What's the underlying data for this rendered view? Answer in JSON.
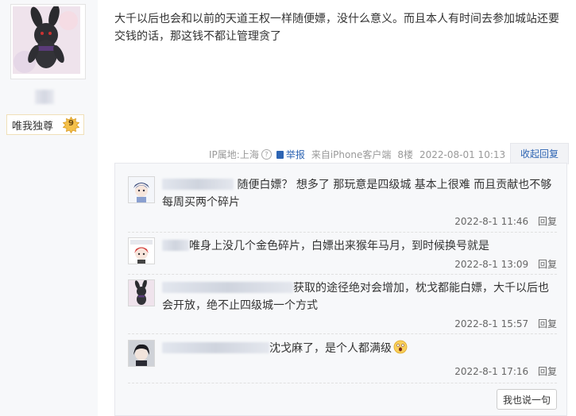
{
  "author": {
    "avatar_icon": "bunny-doll-avatar",
    "badge_name": "唯我独尊",
    "badge_level": "9",
    "badge_color": "#f2b53a"
  },
  "post": {
    "content": "大千以后也会和以前的天道王权一样随便嫖，没什么意义。而且本人有时间去参加城站还要交钱的话，那这钱不都让管理贪了",
    "ip_location": "IP属地:上海",
    "report_label": "举报",
    "source": "来自iPhone客户端",
    "floor": "8楼",
    "timestamp": "2022-08-01 10:13",
    "collapse_label": "收起回复"
  },
  "replies": [
    {
      "avatar_icon": "anime-girl-blue-avatar",
      "text": "随便白嫖？ 想多了 那玩意是四级城 基本上很难 而且贡献也不够每周买两个碎片",
      "time": "2022-8-1 11:46",
      "reply_label": "回复"
    },
    {
      "avatar_icon": "chibi-red-hair-avatar",
      "text": "唯身上没几个金色碎片，白嫖出来猴年马月，到时候换号就是",
      "time": "2022-8-1 13:09",
      "reply_label": "回复"
    },
    {
      "avatar_icon": "bunny-doll-avatar",
      "text": "获取的途径绝对会增加，枕戈都能白嫖，大千以后也会开放，绝不止四级城一个方式",
      "time": "2022-8-1 15:57",
      "reply_label": "回复"
    },
    {
      "avatar_icon": "dark-hair-boy-avatar",
      "text": "沈戈麻了，是个人都满级",
      "emoji_icon": "shocked-face-emoji",
      "time": "2022-8-1 17:16",
      "reply_label": "回复"
    }
  ],
  "say_button_label": "我也说一句",
  "colors": {
    "link_blue": "#2d64b3",
    "meta_gray": "#999999",
    "reply_bg": "#f7f8fa"
  }
}
